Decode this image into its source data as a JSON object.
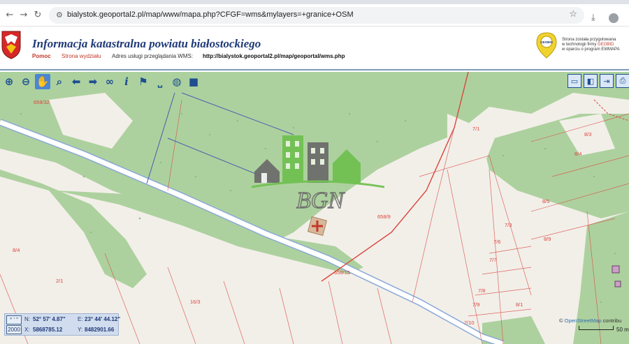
{
  "browser": {
    "url": "bialystok.geoportal2.pl/map/www/mapa.php?CFGF=wms&mylayers=+granice+OSM"
  },
  "header": {
    "title": "Informacja katastralna powiatu białostockiego",
    "help_link": "Pomoc",
    "office_link": "Strona wydziału",
    "wms_label": "Adres usługi przeglądania WMS:",
    "wms_url": "http://bialystok.geoportal2.pl/map/geoportal/wms.php",
    "geobid_line1": "Strona została przygotowana",
    "geobid_line2": "w technologii firmy ",
    "geobid_brand": "GEOBID",
    "geobid_line3": "w oparciu o program EWMAPA",
    "geobid_logo_text": "GEOBID"
  },
  "map": {
    "parcel_labels": [
      "658/32",
      "7/1",
      "8/3",
      "8/4",
      "658/9",
      "8/5",
      "8/9",
      "7/3",
      "7/6",
      "7/7",
      "7/8",
      "7/9",
      "7/10",
      "8/1",
      "16/3",
      "2/1",
      "8/4",
      "658/15"
    ],
    "watermark_text": "BGN",
    "osm_attribution_prefix": "© ",
    "osm_attribution_link": "OpenStreetMap",
    "osm_attribution_suffix": " contribu",
    "scale_label": "50 m"
  },
  "coords": {
    "btn_top": "° ' \"",
    "btn_bottom": "2000",
    "n_label": "N:",
    "n_value": "52° 57' 4.87\"",
    "e_label": "E:",
    "e_value": "23° 44' 44.12\"",
    "x_label": "X:",
    "x_value": "5868785.12",
    "y_label": "Y:",
    "y_value": "8482901.66"
  },
  "colors": {
    "forest": "#add19e",
    "background": "#f2efe9",
    "parcel_line": "#d9463e",
    "road_edge": "#8aa9d6",
    "header_title": "#1f3a78",
    "toolbar_icon": "#1d4f91"
  }
}
